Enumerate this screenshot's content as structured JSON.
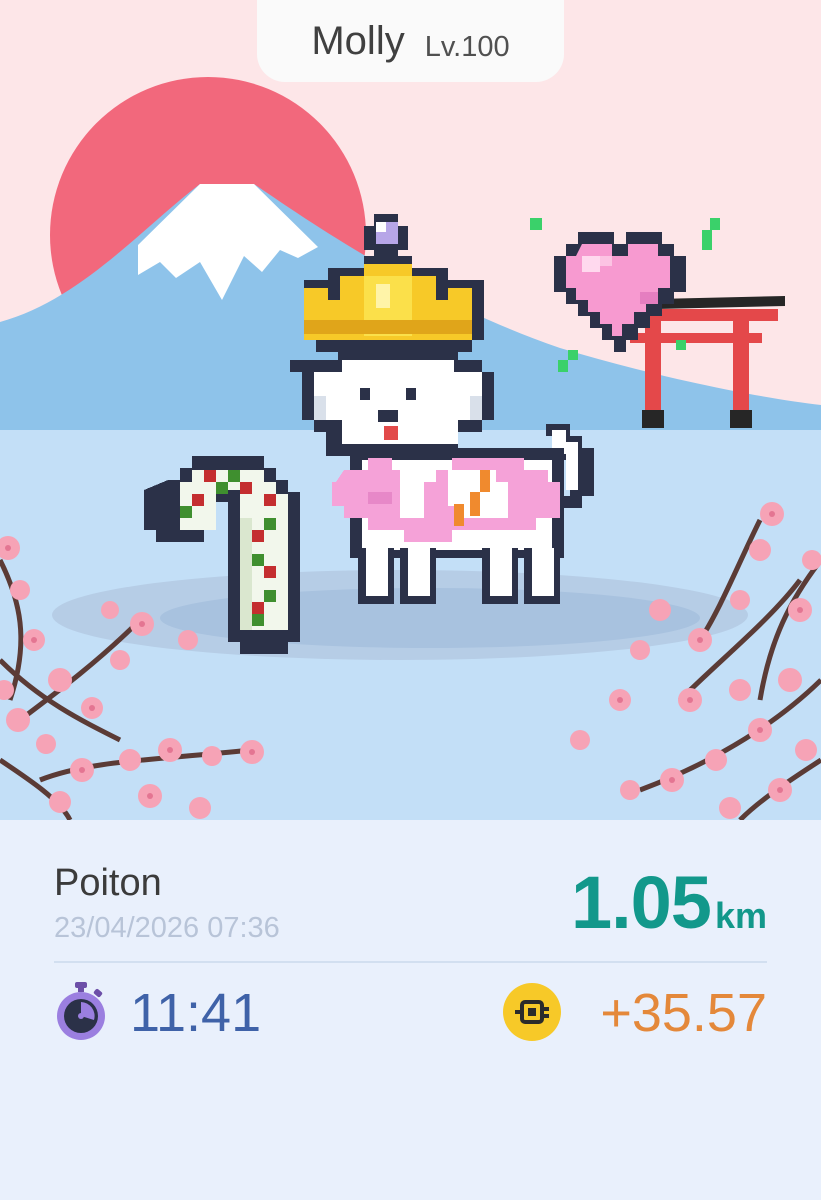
{
  "pet": {
    "name": "Molly",
    "level": "Lv.100"
  },
  "activity": {
    "user": "Poiton",
    "datetime": "23/04/2026 07:36",
    "distance_value": "1.05",
    "distance_unit": "km",
    "duration": "11:41",
    "reward": "+35.57"
  },
  "colors": {
    "sky": "#fde6e8",
    "sun": "#f2687c",
    "mountain": "#8ec3ea",
    "water": "#c3dff7",
    "distance": "#12988b",
    "duration": "#3f62a8",
    "reward": "#e4883a",
    "token": "#f7c928"
  },
  "icons": [
    "stopwatch-icon",
    "token-icon",
    "heart-icon"
  ]
}
